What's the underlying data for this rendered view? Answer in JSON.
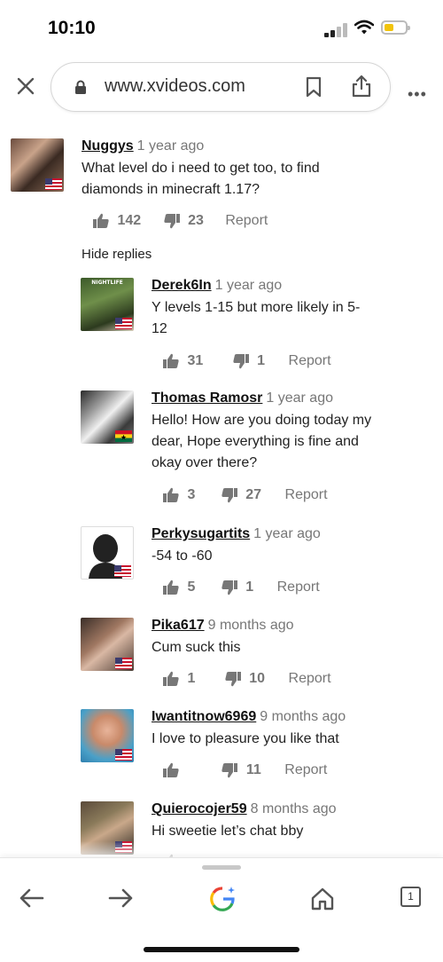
{
  "status_bar": {
    "time": "10:10"
  },
  "browser": {
    "url": "www.xvideos.com",
    "tab_count": "1"
  },
  "thread": {
    "parent": {
      "username": "Nuggys",
      "ago": "1 year ago",
      "lines": [
        "What level do i need to get too, to find",
        "diamonds in minecraft 1.17?"
      ],
      "likes": "142",
      "dislikes": "23",
      "report": "Report"
    },
    "hide_replies": "Hide replies",
    "replies": [
      {
        "username": "Derek6In",
        "ago": "1 year ago",
        "lines": [
          "Y levels 1-15 but more likely in 5-",
          "12"
        ],
        "likes": "31",
        "dislikes": "1",
        "report": "Report",
        "flag": "us"
      },
      {
        "username": "Thomas Ramosr",
        "ago": "1 year ago",
        "lines": [
          "Hello! How are you doing today my",
          "dear, Hope everything is fine and",
          "okay over there?"
        ],
        "likes": "3",
        "dislikes": "27",
        "report": "Report",
        "flag": "gh"
      },
      {
        "username": "Perkysugartits",
        "ago": "1 year ago",
        "lines": [
          "-54 to -60"
        ],
        "likes": "5",
        "dislikes": "1",
        "report": "Report",
        "flag": "us"
      },
      {
        "username": "Pika617",
        "ago": "9 months ago",
        "lines": [
          "Cum suck this"
        ],
        "likes": "1",
        "dislikes": "10",
        "report": "Report",
        "flag": "us"
      },
      {
        "username": "Iwantitnow6969",
        "ago": "9 months ago",
        "lines": [
          "I love to pleasure you like that"
        ],
        "likes": "",
        "dislikes": "11",
        "report": "Report",
        "flag": "us"
      },
      {
        "username": "Quierocojer59",
        "ago": "8 months ago",
        "lines": [
          "Hi sweetie let’s chat bby"
        ],
        "likes": "",
        "dislikes": "",
        "report": "",
        "flag": "us"
      }
    ]
  },
  "icons": {
    "status": [
      "signal-icon",
      "wifi-icon",
      "battery-icon"
    ],
    "toolbar": [
      "close-icon",
      "lock-icon",
      "bookmark-icon",
      "share-icon",
      "more-icon"
    ],
    "bottom_nav": [
      "back-arrow-icon",
      "forward-arrow-icon",
      "google-assistant-icon",
      "home-icon",
      "tabs-icon"
    ]
  },
  "colors": {
    "battery": "#f2c40c",
    "vote_gray": "#777777",
    "text": "#222222"
  }
}
